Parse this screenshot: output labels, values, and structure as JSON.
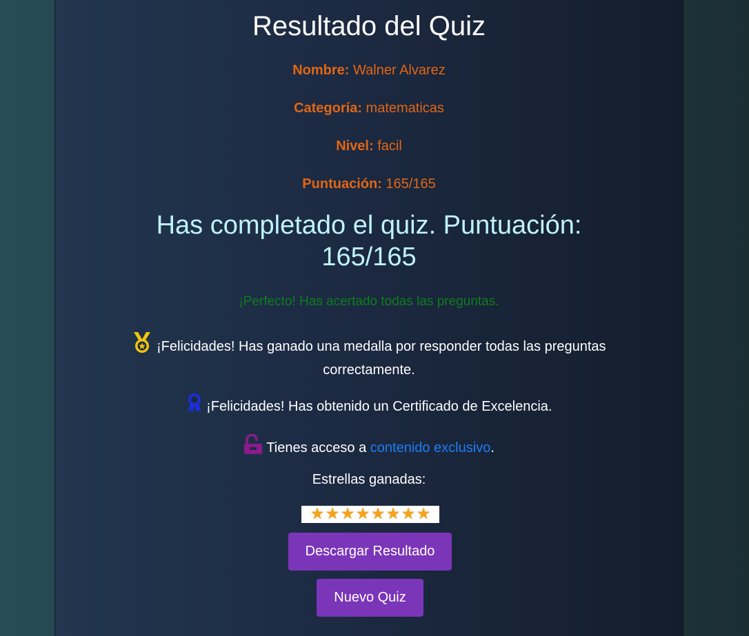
{
  "page": {
    "title": "Resultado del Quiz"
  },
  "info": {
    "name_label": "Nombre:",
    "name_value": "Walner Alvarez",
    "category_label": "Categoría:",
    "category_value": "matematicas",
    "level_label": "Nivel:",
    "level_value": "facil",
    "score_label": "Puntuación:",
    "score_value": "165/165"
  },
  "result": {
    "completed_line1": "Has completado el quiz. Puntuación:",
    "completed_line2": "165/165",
    "perfect_message": "¡Perfecto! Has acertado todas las preguntas."
  },
  "rewards": {
    "medal_icon": "medal-icon",
    "medal_message": "¡Felicidades! Has ganado una medalla por responder todas las preguntas correctamente.",
    "certificate_icon": "ribbon-award-icon",
    "certificate_message": "¡Felicidades! Has obtenido un Certificado de Excelencia.",
    "lock_icon": "unlock-icon",
    "exclusive_prefix": "Tienes acceso a ",
    "exclusive_link": "contenido exclusivo",
    "exclusive_suffix": "."
  },
  "stars": {
    "label": "Estrellas ganadas:",
    "count": 8,
    "glyph": "★"
  },
  "buttons": {
    "download": "Descargar Resultado",
    "new_quiz": "Nuevo Quiz"
  },
  "colors": {
    "info_orange": "#e26614",
    "completed_cyan": "#bff3fb",
    "perfect_green": "#0e7d1c",
    "link_blue": "#1e7df5",
    "button_purple": "#7b35b8",
    "medal_gold": "#f2c40f",
    "certificate_blue": "#1a2fd6",
    "lock_purple": "#8a1b8a",
    "star_orange": "#f5a31b"
  }
}
